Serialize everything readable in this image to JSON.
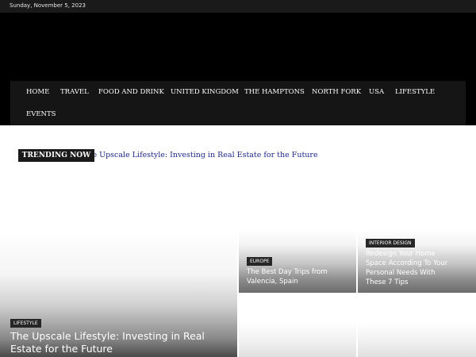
{
  "topbar": {
    "date": "Sunday, November 5, 2023"
  },
  "nav": {
    "items": [
      "HOME",
      "TRAVEL",
      "FOOD AND DRINK",
      "UNITED KINGDOM",
      "THE HAMPTONS",
      "NORTH FORK",
      "USA",
      "LIFESTYLE",
      "EVENTS"
    ]
  },
  "trending": {
    "label": "TRENDING NOW",
    "headline": "The Upscale Lifestyle: Investing in Real Estate for the Future"
  },
  "featured": {
    "category": "LIFESTYLE",
    "title_line1": "The Upscale Lifestyle: Investing in Real",
    "title_line2": "Estate for the Future"
  },
  "card_europe": {
    "category": "EUROPE",
    "title_line1": "The Best Day Trips from",
    "title_line2": "Valencia, Spain"
  },
  "card_interior": {
    "category": "INTERIOR DESIGN",
    "title_line1": "Redesign Your Home",
    "title_line2": "Space According To Your",
    "title_line3": "Personal Needs With",
    "title_line4": "These 7 Tips"
  }
}
